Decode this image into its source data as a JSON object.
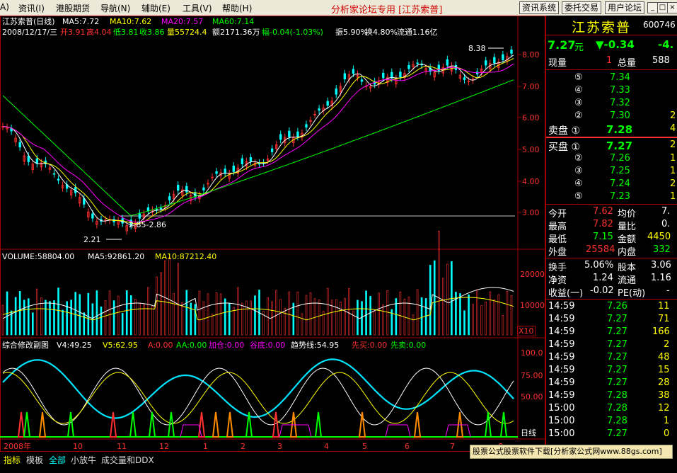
{
  "menu": {
    "items": [
      "资讯(I)",
      "港股期货",
      "导航(N)",
      "辅助(E)",
      "工具(V)",
      "帮助(H)"
    ],
    "center_title": "分析家论坛专用 [江苏索普]",
    "right_buttons": [
      "资讯系统",
      "委托交易",
      "用户论坛"
    ],
    "window_buttons": [
      "_",
      "□",
      "×"
    ]
  },
  "chart": {
    "header_name": "江苏索普(日线)",
    "ma": [
      {
        "label": "MA5:7.72",
        "color": "#ffffff"
      },
      {
        "label": "MA10:7.62",
        "color": "#ffff00"
      },
      {
        "label": "MA20:7.57",
        "color": "#ff00ff"
      },
      {
        "label": "MA60:7.14",
        "color": "#00ff00"
      }
    ],
    "quote_line": {
      "date": "2008/12/17/三",
      "open": "开3.91",
      "high": "高4.04",
      "low": "低3.81",
      "close": "收3.86",
      "volume": "量55724.4",
      "amount": "额2171.36万",
      "change": "幅-0.04(-1.03%)",
      "amplitude": "振5.90%",
      "turnover": "换4.80%",
      "float": "流通1.16亿"
    },
    "annotations": {
      "high": "8.38",
      "low": "2.21",
      "range": "2.85-2.86"
    },
    "price_axis": [
      "8.00",
      "7.00",
      "6.00",
      "5.00",
      "4.00",
      "3.00"
    ],
    "volume_header": {
      "vol": "VOLUME:58804.00",
      "ma5": "MA5:92861.20",
      "ma10": "MA10:87212.40"
    },
    "volume_axis": [
      "20000",
      "10000"
    ],
    "volume_unit": "X10",
    "indicator_header": [
      {
        "label": "综合修改副图",
        "color": "#ffffff"
      },
      {
        "label": "V4:49.25",
        "color": "#ffffff"
      },
      {
        "label": "V5:62.95",
        "color": "#ffff00"
      },
      {
        "label": "A:0.00",
        "color": "#ff3030"
      },
      {
        "label": "AA:0.00",
        "color": "#00ff00"
      },
      {
        "label": "加仓:0.00",
        "color": "#ff00ff"
      },
      {
        "label": "谷底:0.00",
        "color": "#ff00ff"
      },
      {
        "label": "趋势线:54.95",
        "color": "#ffffff"
      },
      {
        "label": "先买:0.00",
        "color": "#ff3030"
      },
      {
        "label": "先卖:0.00",
        "color": "#00ff00"
      }
    ],
    "indicator_axis": [
      "100.0",
      "75.00",
      "50.00"
    ],
    "time_axis": [
      "2008年",
      "10",
      "11",
      "12",
      "1",
      "2",
      "3",
      "4",
      "5",
      "6",
      "7",
      "8"
    ],
    "period_label": "日线"
  },
  "panel": {
    "stock_name": "江苏索普",
    "stock_code": "600746",
    "price": "7.27",
    "price_unit": "元",
    "change": "▼-0.34",
    "change_pct": "-4.",
    "now_vol_label": "现量",
    "now_vol": "1",
    "total_vol_label": "总量",
    "total_vol": "588",
    "sell_rows": [
      {
        "level": "⑤",
        "price": "7.34",
        "vol": ""
      },
      {
        "level": "④",
        "price": "7.33",
        "vol": ""
      },
      {
        "level": "③",
        "price": "7.32",
        "vol": ""
      },
      {
        "level": "②",
        "price": "7.30",
        "vol": "2"
      },
      {
        "level": "卖盘 ①",
        "price": "7.28",
        "vol": "4"
      }
    ],
    "buy_rows": [
      {
        "level": "买盘 ①",
        "price": "7.27",
        "vol": "2"
      },
      {
        "level": "②",
        "price": "7.26",
        "vol": "1"
      },
      {
        "level": "③",
        "price": "7.25",
        "vol": "1"
      },
      {
        "level": "④",
        "price": "7.24",
        "vol": "2"
      },
      {
        "level": "⑤",
        "price": "7.23",
        "vol": "1"
      }
    ],
    "stats": [
      {
        "l1": "今开",
        "v1": "7.62",
        "c1": "#ff3030",
        "l2": "均价",
        "v2": "7."
      },
      {
        "l1": "最高",
        "v1": "7.82",
        "c1": "#ff3030",
        "l2": "量比",
        "v2": "0."
      },
      {
        "l1": "最低",
        "v1": "7.15",
        "c1": "#00ff00",
        "l2": "金额",
        "v2": "4450"
      },
      {
        "l1": "外盘",
        "v1": "25584",
        "c1": "#ff3030",
        "l2": "内盘",
        "v2": "332"
      }
    ],
    "stats2": [
      {
        "l1": "换手",
        "v1": "5.06%",
        "l2": "股本",
        "v2": "3.06"
      },
      {
        "l1": "净资",
        "v1": "1.24",
        "l2": "流通",
        "v2": "1.16"
      },
      {
        "l1": "收益(一)",
        "v1": "-0.02",
        "l2": "PE(动)",
        "v2": "-"
      }
    ],
    "ticks": [
      {
        "time": "14:59",
        "price": "7.26",
        "vol": "11"
      },
      {
        "time": "14:59",
        "price": "7.27",
        "vol": "71"
      },
      {
        "time": "14:59",
        "price": "7.27",
        "vol": "166"
      },
      {
        "time": "14:59",
        "price": "7.27",
        "vol": "2"
      },
      {
        "time": "14:59",
        "price": "7.27",
        "vol": "48"
      },
      {
        "time": "14:59",
        "price": "7.27",
        "vol": "15"
      },
      {
        "time": "14:59",
        "price": "7.27",
        "vol": "28"
      },
      {
        "time": "14:59",
        "price": "7.28",
        "vol": "38"
      },
      {
        "time": "15:00",
        "price": "7.28",
        "vol": "12"
      },
      {
        "time": "15:00",
        "price": "7.28",
        "vol": "1"
      },
      {
        "time": "15:00",
        "price": "7.27",
        "vol": "0"
      }
    ]
  },
  "bottom_tabs": [
    "指标",
    "模板",
    "全部",
    "小放牛",
    "成交量和DDX"
  ],
  "ad_text": "股票公式股票软件下载[分析家公式网www.88gs.com]"
}
